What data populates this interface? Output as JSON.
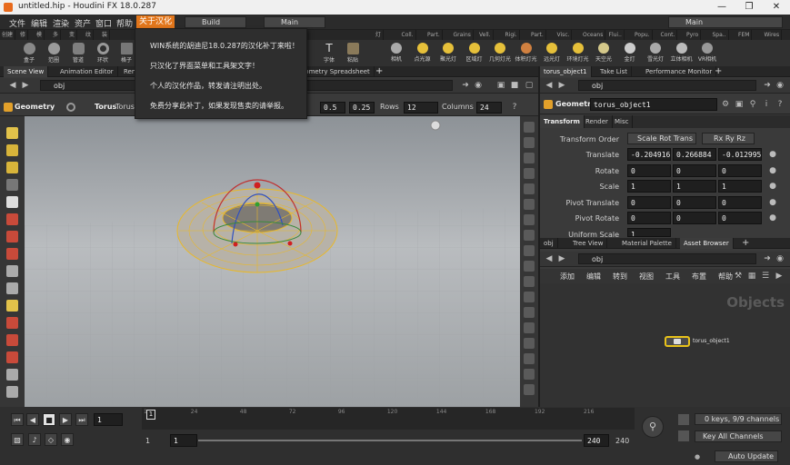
{
  "window": {
    "title": "untitled.hip - Houdini FX 18.0.287",
    "controls": [
      "—",
      "❐",
      "✕"
    ]
  },
  "menubar": {
    "items": [
      "文件",
      "编辑",
      "渲染",
      "资产",
      "窗口",
      "帮助"
    ],
    "highlight": "关于汉化",
    "desktop": "Build",
    "main_pane": "Main",
    "right_main": "Main"
  },
  "shelf": {
    "left_tabs": [
      "创建",
      "修",
      "模",
      "多",
      "变",
      "纹",
      "装"
    ],
    "left_tools": [
      "盒子",
      "范圈",
      "管道",
      "环状",
      "格子"
    ],
    "right_tabs": [
      "灯",
      "Coll.",
      "Part.",
      "Grains",
      "Vell.",
      "Rigi.",
      "Part.",
      "Visc.",
      "Oceans",
      "Flui..",
      "Popu.",
      "Cont.",
      "Pyro",
      "Spa..",
      "FEM",
      "Wires"
    ],
    "right_tools": [
      "相机",
      "点光源",
      "聚光灯",
      "区域灯",
      "几何灯光",
      "体积灯光",
      "远光灯",
      "环境灯光",
      "天空光",
      "金灯",
      "雪光灯",
      "立体相机",
      "VR相机"
    ],
    "extra_left": [
      "T",
      "字体",
      "粘贴"
    ]
  },
  "popup": {
    "lines": [
      "WIN系统的胡迪尼18.0.287的汉化补丁来啦！",
      "只汉化了界面菜单和工具架文字！",
      "个人的汉化作品，转发请注明出处。",
      "免费分享此补丁，如果发现售卖的请举报。"
    ]
  },
  "left_panel": {
    "tabs": [
      "Scene View",
      "Animation Editor",
      "Rend",
      "eometry Spreadsheet"
    ],
    "path": "obj",
    "geometry_label": "Geometry",
    "node_label": "Torus",
    "node_type": "Torus Primit",
    "rows_label": "Rows",
    "rows_value": "12",
    "cols_label": "Columns",
    "cols_value": "24",
    "rad1": "0.5",
    "rad2": "0.25",
    "vp_persp": "B"
  },
  "param_panel": {
    "tabs": [
      "torus_object1",
      "Take List",
      "Performance Monitor"
    ],
    "path": "obj",
    "node_type": "Geometry",
    "node_name": "torus_object1",
    "subtabs": [
      "Transform",
      "Render",
      "Misc"
    ],
    "transform_order_label": "Transform Order",
    "transform_order": "Scale Rot Trans",
    "rot_order": "Rx Ry Rz",
    "rows": [
      {
        "label": "Translate",
        "v": [
          "-0.204916",
          "0.266884",
          "-0.012995"
        ]
      },
      {
        "label": "Rotate",
        "v": [
          "0",
          "0",
          "0"
        ]
      },
      {
        "label": "Scale",
        "v": [
          "1",
          "1",
          "1"
        ]
      },
      {
        "label": "Pivot Translate",
        "v": [
          "0",
          "0",
          "0"
        ]
      },
      {
        "label": "Pivot Rotate",
        "v": [
          "0",
          "0",
          "0"
        ]
      }
    ],
    "cut_label": "Uniform Scale",
    "cut_value": "1"
  },
  "network_panel": {
    "tabs": [
      "obj",
      "Tree View",
      "Material Palette",
      "Asset Browser"
    ],
    "path": "obj",
    "menu": [
      "添加",
      "编辑",
      "转到",
      "视图",
      "工具",
      "布置",
      "帮助"
    ],
    "watermark": "Objects",
    "node_name": "torus_object1"
  },
  "timeline": {
    "frame": "1",
    "start": "1",
    "start2": "1",
    "end": "240",
    "end2": "240",
    "ticks": [
      "1",
      "24",
      "48",
      "72",
      "96",
      "120",
      "144",
      "168",
      "192",
      "216"
    ],
    "keys": "0 keys, 9/9 channels",
    "channels": "Key All Channels",
    "auto_update": "Auto Update"
  },
  "colors": {
    "accent": "#e2761b",
    "bg": "#3a3a3a",
    "viewport": "#a9acaf",
    "torus": "#b7b2a8",
    "wire": "#e8b82a"
  }
}
